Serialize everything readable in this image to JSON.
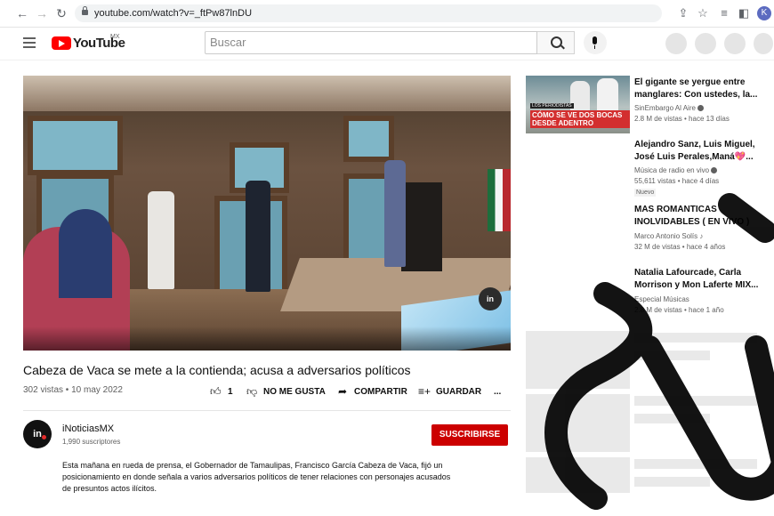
{
  "browser": {
    "url": "youtube.com/watch?v=_ftPw87lnDU",
    "profile_initial": "K"
  },
  "header": {
    "logo_text": "YouTube",
    "region": "MX",
    "search_placeholder": "Buscar"
  },
  "video": {
    "title": "Cabeza de Vaca se mete a la contienda; acusa a adversarios políticos",
    "views_date": "302 vistas • 10 may 2022",
    "likes": "1",
    "dislike_label": "NO ME GUSTA",
    "share_label": "COMPARTIR",
    "save_label": "GUARDAR",
    "more_label": "...",
    "overlay_badge": "in"
  },
  "channel": {
    "avatar_text": "in",
    "name": "iNoticiasMX",
    "subscribers": "1,990 suscriptores",
    "subscribe_label": "SUSCRIBIRSE",
    "description": "Esta mañana en rueda de prensa, el Gobernador de Tamaulipas, Francisco García Cabeza de Vaca, fijó un posicionamiento en donde señala a varios adversarios políticos de tener relaciones con personajes acusados de presuntos actos ilícitos."
  },
  "recommendations": [
    {
      "title": "El gigante se yergue entre manglares: Con ustedes, la...",
      "channel": "SinEmbargo Al Aire",
      "stats": "2.8 M de vistas • hace 13 días",
      "thumb_tag": "LOS PERIODISTAS",
      "thumb_caption": "CÓMO SE VE DOS BOCAS DESDE ADENTRO"
    },
    {
      "title": "Alejandro Sanz, Luis Miguel, José Luis Perales,Maná💖...",
      "channel": "Música de radio en vivo",
      "stats": "55,611 vistas • hace 4 días",
      "badge": "Nuevo"
    },
    {
      "title": "MAS ROMANTICAS INOLVIDABLES ( EN VIVO )",
      "channel": "Marco Antonio Solís ♪",
      "stats": "32 M de vistas • hace 4 años"
    },
    {
      "title": "Natalia Lafourcade, Carla Morrison y Mon Laferte MIX...",
      "channel": "Especial Músicas",
      "stats": "2.8 M de vistas • hace 1 año"
    }
  ],
  "colors": {
    "brand_red": "#ff0000",
    "subscribe_red": "#cc0000"
  }
}
